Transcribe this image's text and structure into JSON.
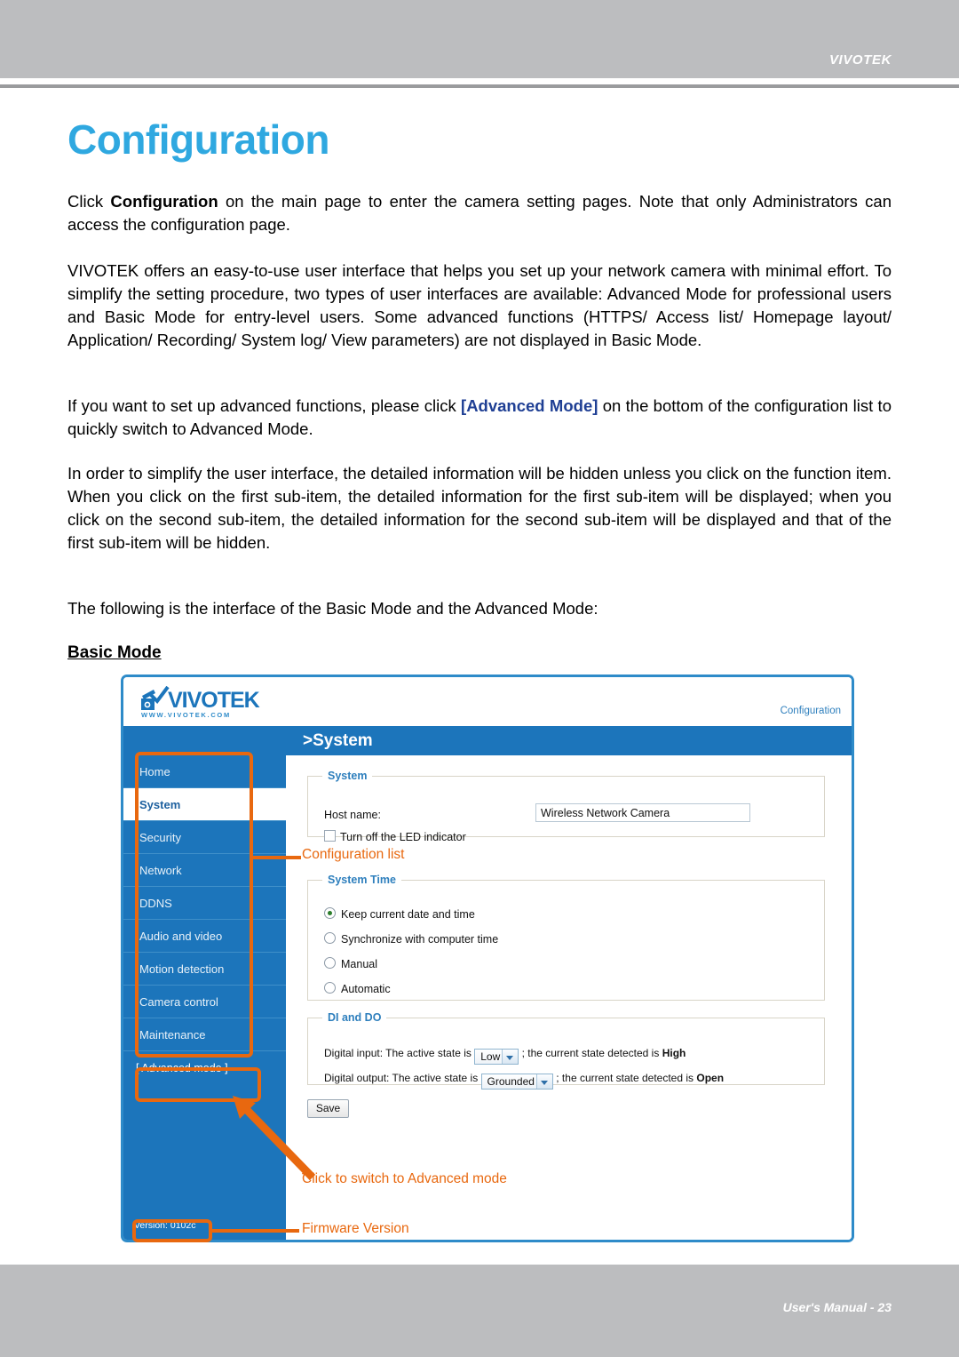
{
  "header": {
    "brand": "VIVOTEK"
  },
  "page": {
    "title": "Configuration",
    "paragraphs": {
      "p1_a": "Click ",
      "p1_b": "Configuration",
      "p1_c": " on the main page to enter the camera setting pages. Note that only Administrators can access the configuration page.",
      "p2": "VIVOTEK offers an easy-to-use user interface that helps you set up your network camera with minimal effort. To simplify the setting procedure, two types of user interfaces are available: Advanced Mode for professional users and Basic Mode for entry-level users. Some advanced functions (HTTPS/ Access list/ Homepage layout/ Application/ Recording/ System log/ View parameters) are not displayed in Basic Mode.",
      "p3_a": "If you want to set up advanced functions, please click ",
      "p3_b": "[Advanced Mode]",
      "p3_c": " on the bottom of the configuration list to quickly switch to Advanced Mode.",
      "p4": "In order to simplify the user interface, the detailed information will be hidden unless you click on the function item. When you click on the first sub-item, the detailed information for the first sub-item will be displayed; when you click on the second sub-item, the detailed information for the second sub-item will be displayed and that of the first sub-item will be hidden.",
      "p5": "The following is the interface of the Basic Mode and the Advanced Mode:"
    },
    "basic_mode_heading": "Basic Mode"
  },
  "screenshot": {
    "logo": {
      "word": "VIVOTEK",
      "url": "WWW.VIVOTEK.COM"
    },
    "config_link": "Configuration",
    "title_bar": ">System",
    "sidebar": {
      "items": [
        {
          "label": "Home",
          "active": false
        },
        {
          "label": "System",
          "active": true
        },
        {
          "label": "Security",
          "active": false
        },
        {
          "label": "Network",
          "active": false
        },
        {
          "label": "DDNS",
          "active": false
        },
        {
          "label": "Audio and video",
          "active": false
        },
        {
          "label": "Motion detection",
          "active": false
        },
        {
          "label": "Camera control",
          "active": false
        },
        {
          "label": "Maintenance",
          "active": false
        }
      ],
      "advanced_mode_button": "[ Advanced mode ]",
      "version": "Version: 0102c"
    },
    "system_box": {
      "legend": "System",
      "host_label": "Host name:",
      "host_value": "Wireless Network Camera",
      "led_checkbox_label": "Turn off the LED indicator",
      "led_checked": false
    },
    "system_time_box": {
      "legend": "System Time",
      "options": [
        {
          "label": "Keep current date and time",
          "selected": true
        },
        {
          "label": "Synchronize with computer time",
          "selected": false
        },
        {
          "label": "Manual",
          "selected": false
        },
        {
          "label": "Automatic",
          "selected": false
        }
      ]
    },
    "di_do_box": {
      "legend": "DI and DO",
      "di_prefix": "Digital input: The active state is",
      "di_select_value": "Low",
      "di_suffix": "; the current state detected is",
      "di_state": "High",
      "do_prefix": "Digital output: The active state is",
      "do_select_value": "Grounded",
      "do_suffix": "; the current state detected is",
      "do_state": "Open"
    },
    "save_button": "Save"
  },
  "annotations": {
    "configuration_list": "Configuration list",
    "click_to_switch": "Click to switch to Advanced mode",
    "firmware_version": "Firmware Version",
    "color": "#e8680f"
  },
  "footer": {
    "note": "User's Manual - 23"
  },
  "colors": {
    "accent_blue": "#2fa8e0",
    "ui_blue": "#1c75bb",
    "annotation_orange": "#e8680f",
    "header_gray": "#bcbdbf",
    "link_blue": "#1f3f94"
  }
}
